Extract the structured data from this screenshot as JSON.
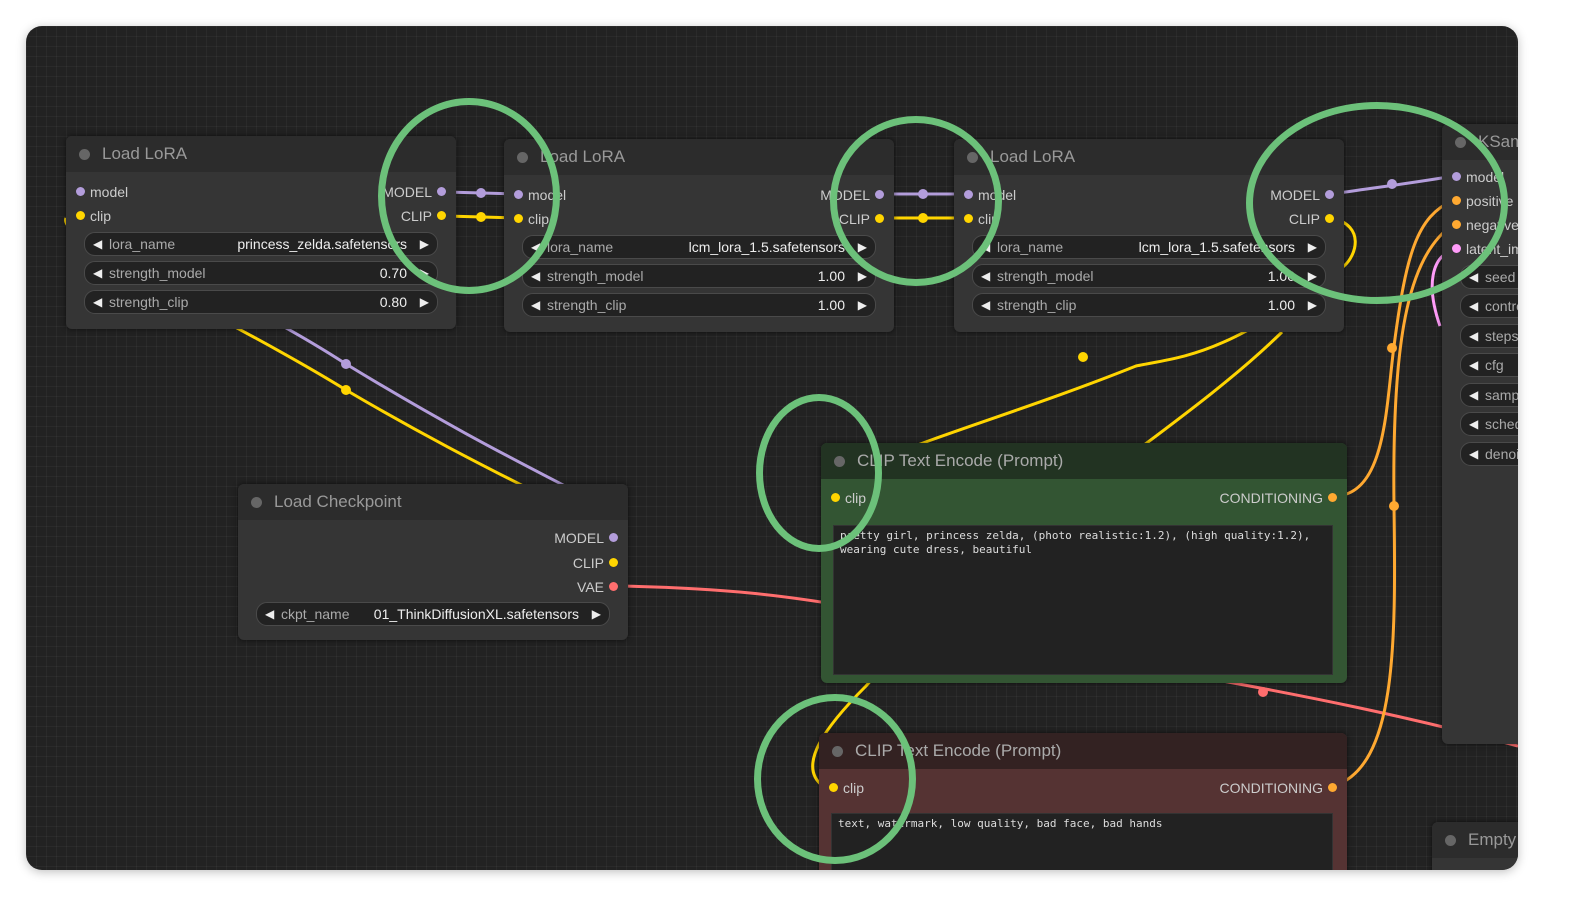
{
  "colors": {
    "model": "#b39ddb",
    "clip": "#ffd500",
    "vae": "#ff6e6e",
    "conditioning": "#ffa931",
    "latent": "#ff9cf9",
    "highlight": "#6cc17a"
  },
  "lora1": {
    "title": "Load LoRA",
    "inputs": [
      "model",
      "clip"
    ],
    "outputs": [
      "MODEL",
      "CLIP"
    ],
    "widgets": [
      {
        "name": "lora_name",
        "value": "princess_zelda.safetensors"
      },
      {
        "name": "strength_model",
        "value": "0.70"
      },
      {
        "name": "strength_clip",
        "value": "0.80"
      }
    ]
  },
  "lora2": {
    "title": "Load LoRA",
    "inputs": [
      "model",
      "clip"
    ],
    "outputs": [
      "MODEL",
      "CLIP"
    ],
    "widgets": [
      {
        "name": "lora_name",
        "value": "lcm_lora_1.5.safetensors"
      },
      {
        "name": "strength_model",
        "value": "1.00"
      },
      {
        "name": "strength_clip",
        "value": "1.00"
      }
    ]
  },
  "lora3": {
    "title": "Load LoRA",
    "inputs": [
      "model",
      "clip"
    ],
    "outputs": [
      "MODEL",
      "CLIP"
    ],
    "widgets": [
      {
        "name": "lora_name",
        "value": "lcm_lora_1.5.safetensors"
      },
      {
        "name": "strength_model",
        "value": "1.00"
      },
      {
        "name": "strength_clip",
        "value": "1.00"
      }
    ]
  },
  "checkpoint": {
    "title": "Load Checkpoint",
    "outputs": [
      "MODEL",
      "CLIP",
      "VAE"
    ],
    "widget": {
      "name": "ckpt_name",
      "value": "01_ThinkDiffusionXL.safetensors"
    }
  },
  "clip_pos": {
    "title": "CLIP Text Encode (Prompt)",
    "input": "clip",
    "output": "CONDITIONING",
    "text": "pretty girl, princess zelda, (photo realistic:1.2), (high quality:1.2),\nwearing cute dress, beautiful"
  },
  "clip_neg": {
    "title": "CLIP Text Encode (Prompt)",
    "input": "clip",
    "output": "CONDITIONING",
    "text": "text, watermark, low quality, bad face, bad hands"
  },
  "ksampler": {
    "title": "KSampler",
    "inputs": [
      "model",
      "positive",
      "negative",
      "latent_image"
    ],
    "widgets": [
      "seed",
      "control_after_generate",
      "steps",
      "cfg",
      "sampler_name",
      "scheduler",
      "denoise"
    ]
  },
  "empty_latent": {
    "title": "Empty Latent Image"
  }
}
